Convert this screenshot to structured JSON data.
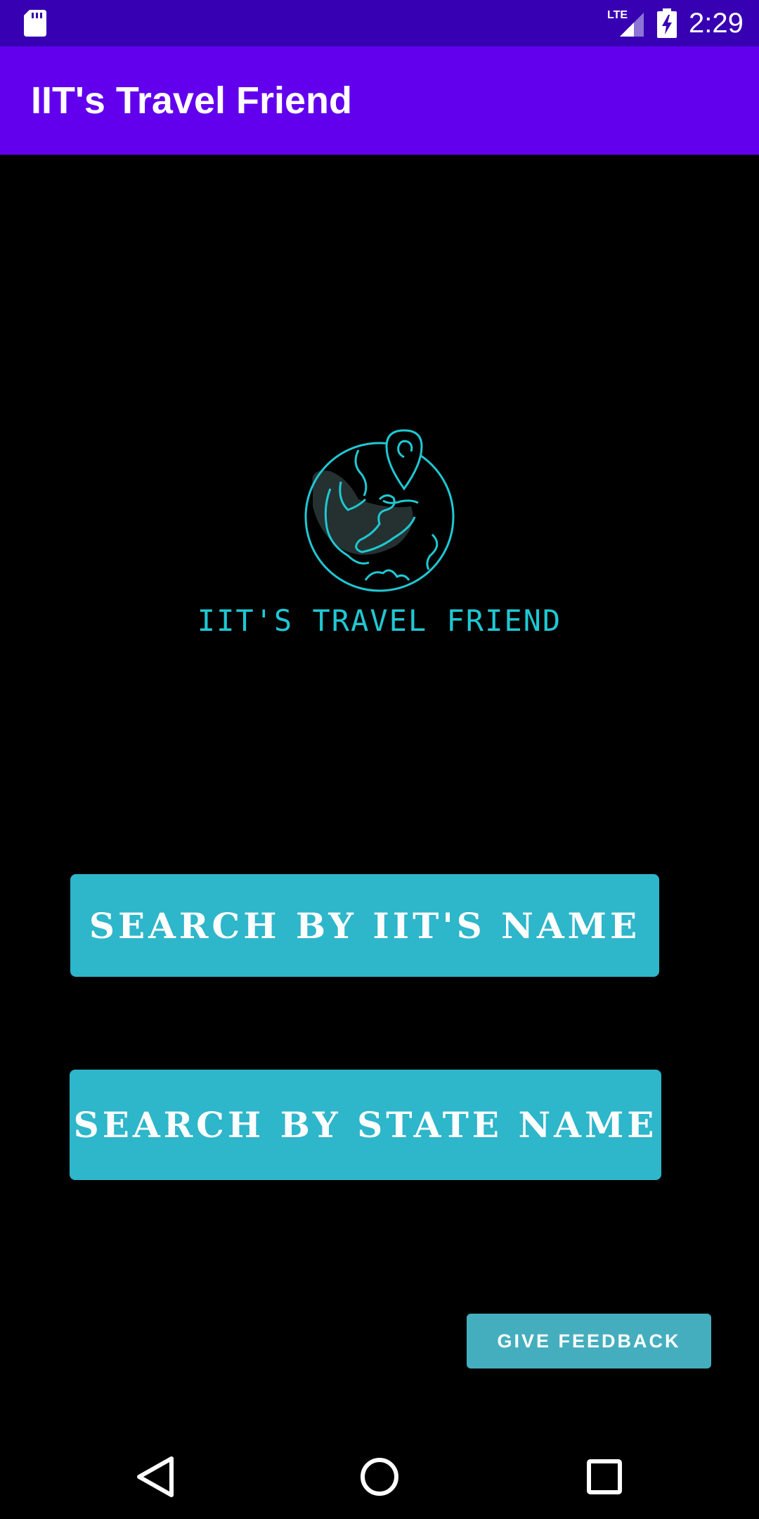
{
  "status_bar": {
    "time": "2:29",
    "network_label": "LTE",
    "icons": [
      "sd-card-icon",
      "lte-signal-icon",
      "battery-charging-icon"
    ]
  },
  "app_bar": {
    "title": "IIT's Travel Friend"
  },
  "logo": {
    "text": "IIT'S TRAVEL FRIEND",
    "icon": "globe-location-pin-icon"
  },
  "buttons": {
    "search_iit": "SEARCH BY IIT'S NAME",
    "search_state": "SEARCH BY STATE NAME",
    "feedback": "GIVE FEEDBACK"
  },
  "nav_bar": {
    "icons": [
      "back-icon",
      "home-icon",
      "recents-icon"
    ]
  },
  "colors": {
    "status_bar": "#3700b3",
    "app_bar": "#6200ee",
    "background": "#000000",
    "button": "#2eb6ca",
    "feedback_button": "#45aebe",
    "logo_accent": "#1fc8d3"
  }
}
